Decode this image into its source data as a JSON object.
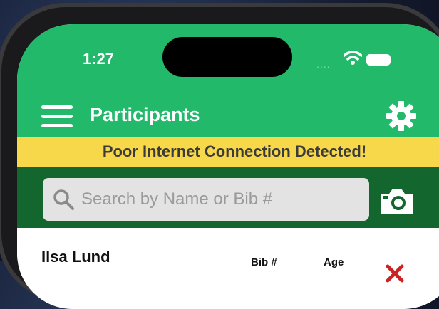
{
  "status_bar": {
    "time": "1:27",
    "signal_dots": "....",
    "icons": [
      "wifi-icon",
      "battery-icon"
    ]
  },
  "app_bar": {
    "title": "Participants",
    "background_color": "#22b96a",
    "icons": [
      "menu-icon",
      "gear-icon"
    ]
  },
  "banner": {
    "text": "Poor Internet Connection Detected!",
    "background_color": "#f6d84a"
  },
  "search": {
    "placeholder": "Search by Name or Bib #",
    "value": "",
    "section_color": "#14662f",
    "icons": [
      "search-icon",
      "camera-icon"
    ]
  },
  "participants": {
    "columns": {
      "bib": "Bib #",
      "age": "Age"
    },
    "rows": [
      {
        "name": "Ilsa Lund",
        "action_icon": "delete-icon"
      }
    ]
  }
}
